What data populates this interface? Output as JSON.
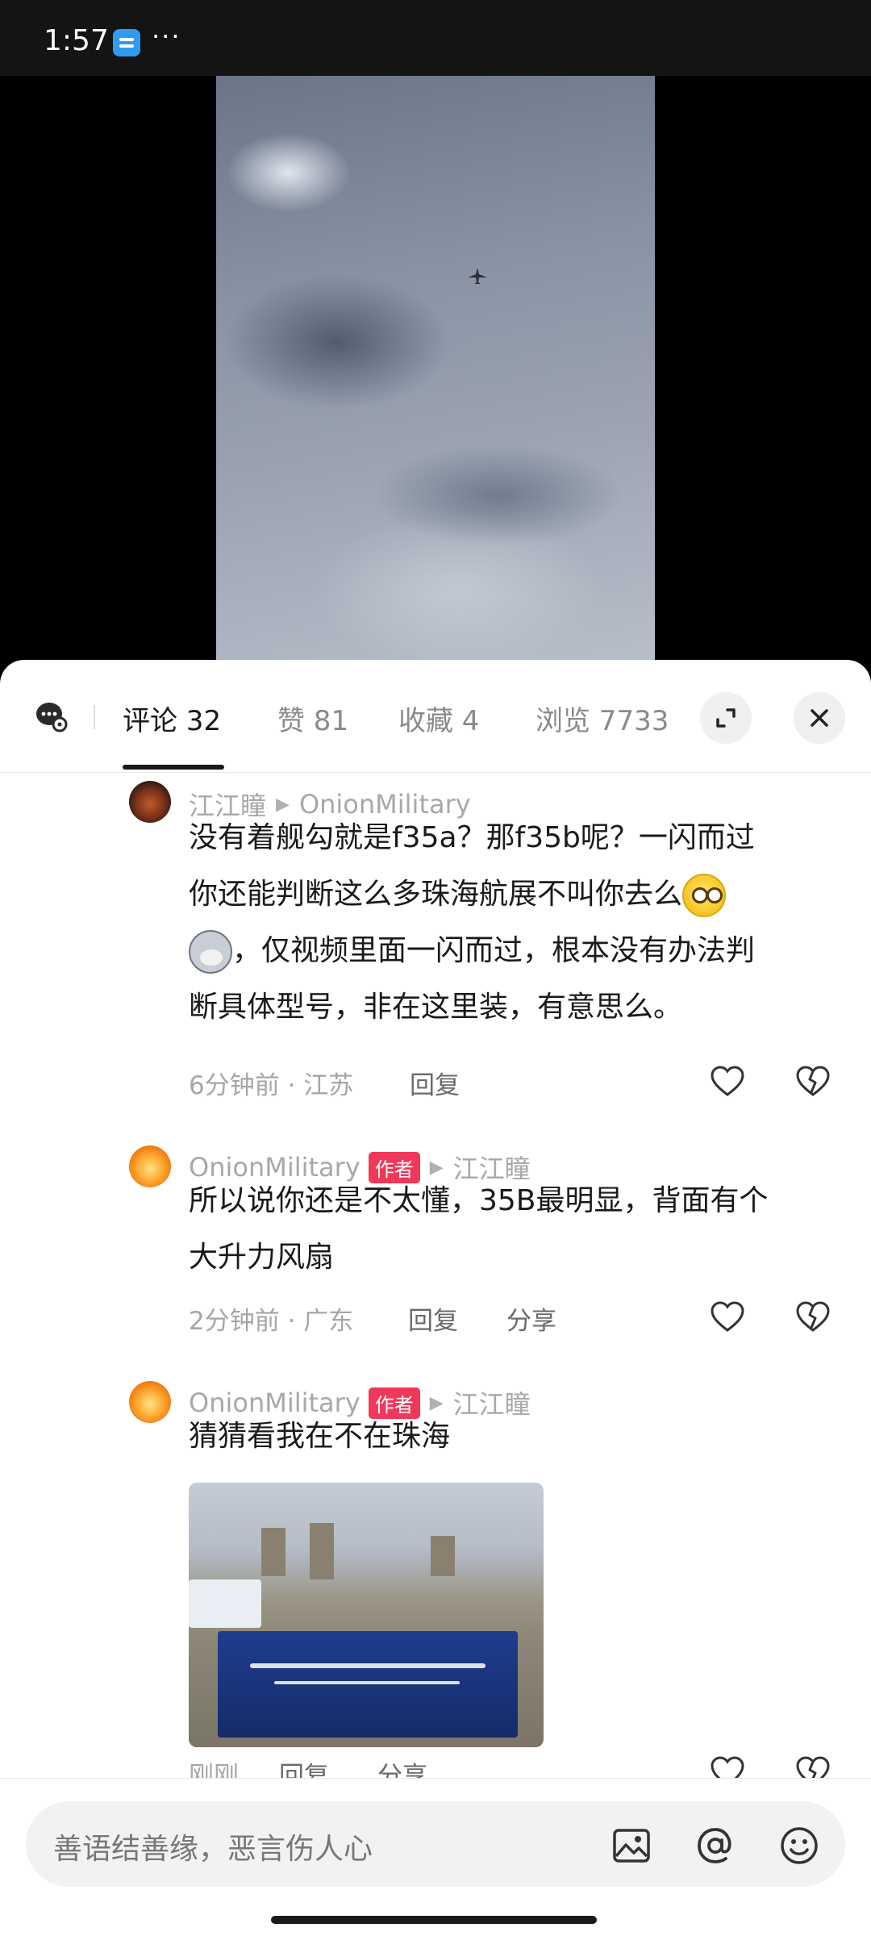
{
  "status_bar": {
    "time": "1:57",
    "more": "···"
  },
  "tabs": [
    {
      "label": "评论 32",
      "active": true
    },
    {
      "label": "赞 81",
      "active": false
    },
    {
      "label": "收藏 4",
      "active": false
    },
    {
      "label": "浏览 7733",
      "active": false
    }
  ],
  "comments": [
    {
      "user": "江江瞳",
      "reply_to": "OnionMilitary",
      "text_line1": "没有着舰勾就是f35a？那f35b呢？一闪而过",
      "text_line2": "你还能判断这么多珠海航展不叫你去么",
      "text_line3": "，仅视频里面一闪而过，根本没有办法判",
      "text_line4": "断具体型号，非在这里装，有意思么。",
      "time_location": "6分钟前 · 江苏",
      "reply": "回复"
    },
    {
      "user": "OnionMilitary",
      "badge": "作者",
      "reply_to": "江江瞳",
      "text_line1": "所以说你还是不太懂，35B最明显，背面有个",
      "text_line2": "大升力风扇",
      "time_location": "2分钟前 · 广东",
      "reply": "回复",
      "share": "分享"
    },
    {
      "user": "OnionMilitary",
      "badge": "作者",
      "reply_to": "江江瞳",
      "text_line1": "猜猜看我在不在珠海",
      "time_location": "刚刚",
      "reply": "回复",
      "share": "分享"
    }
  ],
  "input": {
    "placeholder": "善语结善缘，恶言伤人心"
  },
  "icons": {
    "danmaku": "danmaku-settings-icon",
    "expand": "expand-icon",
    "close": "close-icon",
    "like": "heart-icon",
    "dislike": "broken-heart-icon",
    "image": "image-icon",
    "mention": "at-icon",
    "emoji": "emoji-icon"
  },
  "colors": {
    "author_badge": "#f0385a",
    "sheet_bg": "#ffffff"
  }
}
